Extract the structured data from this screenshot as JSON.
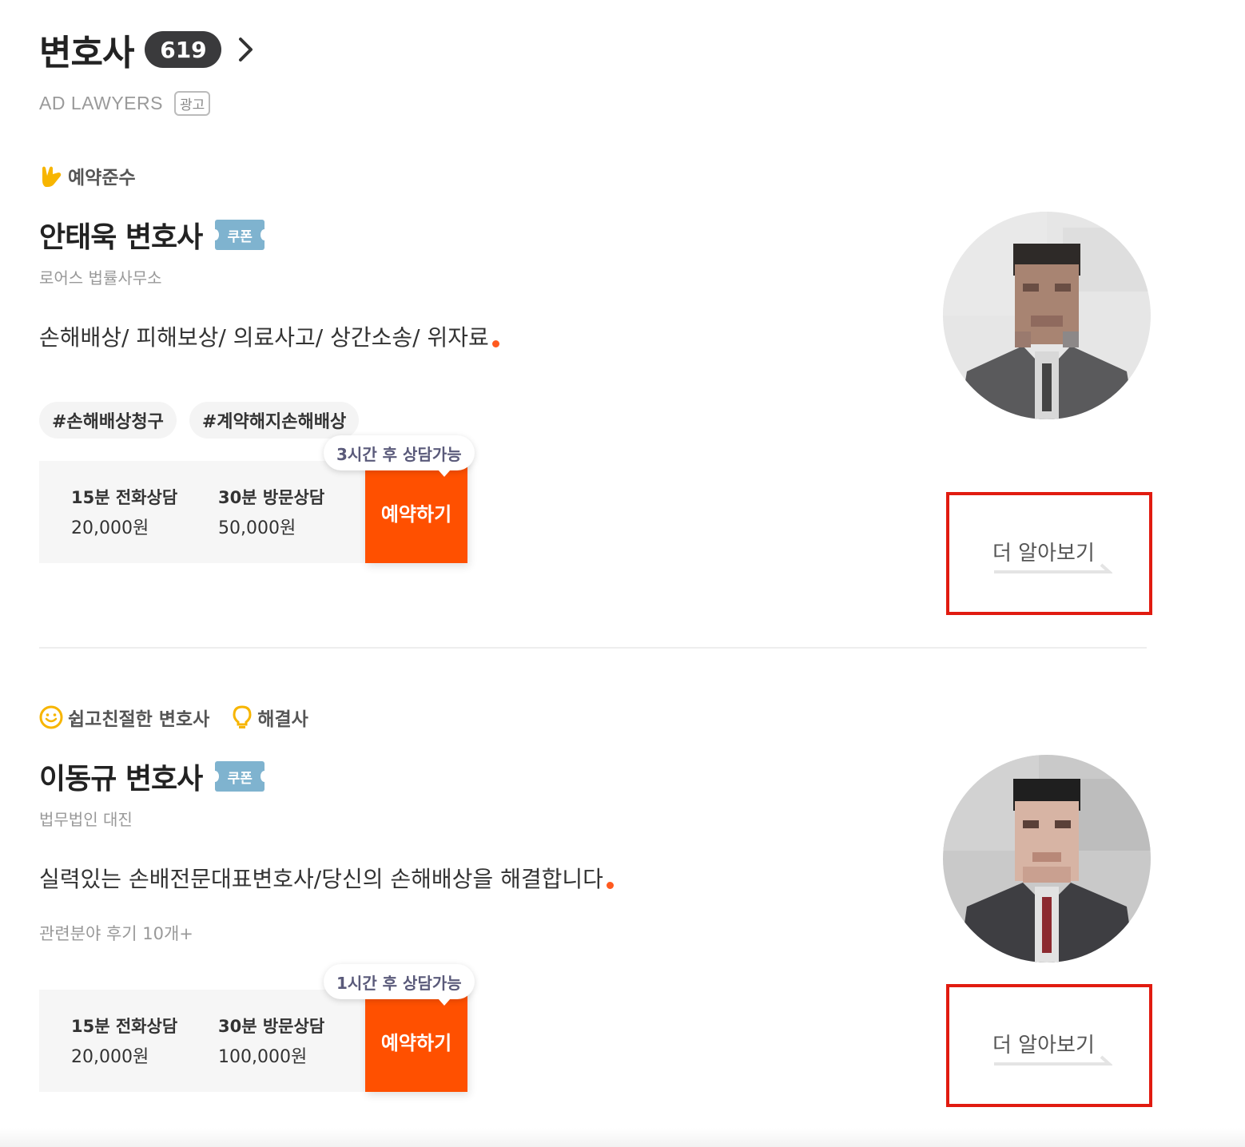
{
  "header": {
    "title": "변호사",
    "count": "619"
  },
  "ad": {
    "label": "AD LAWYERS",
    "badge": "광고"
  },
  "lawyers": [
    {
      "badges": [
        {
          "icon": "hand-sign-icon",
          "label": "예약준수"
        }
      ],
      "name": "안태욱 변호사",
      "coupon": "쿠폰",
      "firm": "로어스 법률사무소",
      "intro": "손해배상/ 피해보상/ 의료사고/ 상간소송/ 위자료",
      "tags": [
        "#손해배상청구",
        "#계약해지손해배상"
      ],
      "reviews": "",
      "consult": [
        {
          "label": "15분 전화상담",
          "price": "20,000원"
        },
        {
          "label": "30분 방문상담",
          "price": "50,000원"
        }
      ],
      "availability": "3시간 후 상담가능",
      "reserve_label": "예약하기",
      "more_label": "더 알아보기"
    },
    {
      "badges": [
        {
          "icon": "smile-icon",
          "label": "쉽고친절한 변호사"
        },
        {
          "icon": "lightbulb-icon",
          "label": "해결사"
        }
      ],
      "name": "이동규 변호사",
      "coupon": "쿠폰",
      "firm": "법무법인 대진",
      "intro": "실력있는 손배전문대표변호사/당신의 손해배상을 해결합니다",
      "tags": [],
      "reviews": "관련분야 후기 10개+",
      "consult": [
        {
          "label": "15분 전화상담",
          "price": "20,000원"
        },
        {
          "label": "30분 방문상담",
          "price": "100,000원"
        }
      ],
      "availability": "1시간 후 상담가능",
      "reserve_label": "예약하기",
      "more_label": "더 알아보기"
    }
  ],
  "colors": {
    "accent": "#ff5000",
    "highlight_border": "#e11b10",
    "badge_dark": "#3a3a3c",
    "coupon": "#7fb3cf"
  }
}
